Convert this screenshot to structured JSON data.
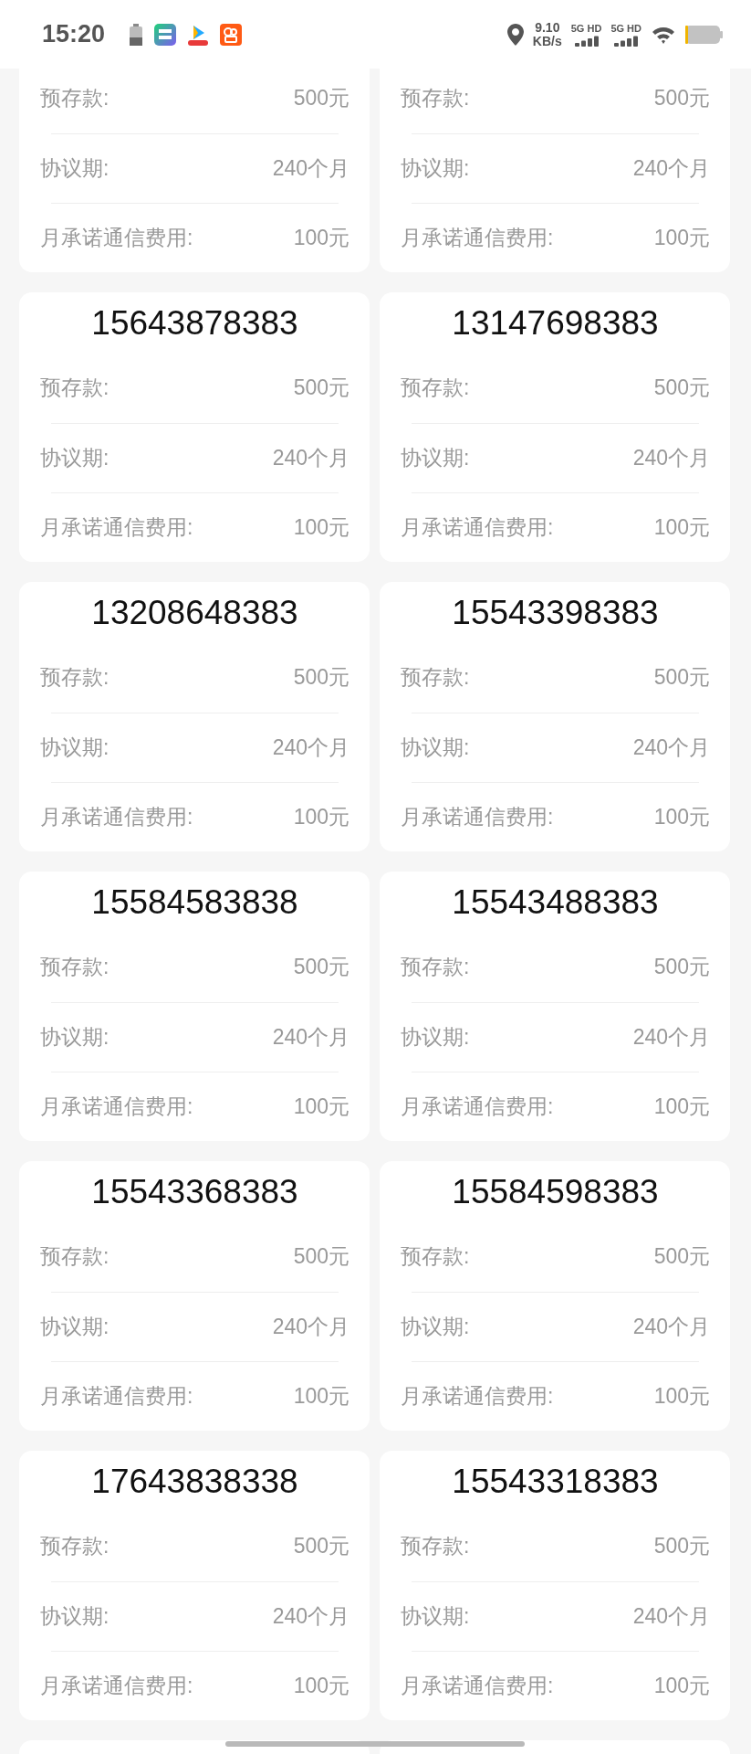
{
  "status_bar": {
    "time": "15:20",
    "speed": "9.10",
    "speed_unit": "KB/s",
    "networks": [
      "5G HD",
      "5G HD"
    ]
  },
  "cards": [
    {
      "details": [
        {
          "label": "预存款:",
          "value": "500元"
        },
        {
          "label": "协议期:",
          "value": "240个月"
        },
        {
          "label": "月承诺通信费用:",
          "value": "100元"
        }
      ]
    },
    {
      "details": [
        {
          "label": "预存款:",
          "value": "500元"
        },
        {
          "label": "协议期:",
          "value": "240个月"
        },
        {
          "label": "月承诺通信费用:",
          "value": "100元"
        }
      ]
    },
    {
      "number": "15643878383",
      "details": [
        {
          "label": "预存款:",
          "value": "500元"
        },
        {
          "label": "协议期:",
          "value": "240个月"
        },
        {
          "label": "月承诺通信费用:",
          "value": "100元"
        }
      ]
    },
    {
      "number": "13147698383",
      "details": [
        {
          "label": "预存款:",
          "value": "500元"
        },
        {
          "label": "协议期:",
          "value": "240个月"
        },
        {
          "label": "月承诺通信费用:",
          "value": "100元"
        }
      ]
    },
    {
      "number": "13208648383",
      "details": [
        {
          "label": "预存款:",
          "value": "500元"
        },
        {
          "label": "协议期:",
          "value": "240个月"
        },
        {
          "label": "月承诺通信费用:",
          "value": "100元"
        }
      ]
    },
    {
      "number": "15543398383",
      "details": [
        {
          "label": "预存款:",
          "value": "500元"
        },
        {
          "label": "协议期:",
          "value": "240个月"
        },
        {
          "label": "月承诺通信费用:",
          "value": "100元"
        }
      ]
    },
    {
      "number": "15584583838",
      "details": [
        {
          "label": "预存款:",
          "value": "500元"
        },
        {
          "label": "协议期:",
          "value": "240个月"
        },
        {
          "label": "月承诺通信费用:",
          "value": "100元"
        }
      ]
    },
    {
      "number": "15543488383",
      "details": [
        {
          "label": "预存款:",
          "value": "500元"
        },
        {
          "label": "协议期:",
          "value": "240个月"
        },
        {
          "label": "月承诺通信费用:",
          "value": "100元"
        }
      ]
    },
    {
      "number": "15543368383",
      "details": [
        {
          "label": "预存款:",
          "value": "500元"
        },
        {
          "label": "协议期:",
          "value": "240个月"
        },
        {
          "label": "月承诺通信费用:",
          "value": "100元"
        }
      ]
    },
    {
      "number": "15584598383",
      "details": [
        {
          "label": "预存款:",
          "value": "500元"
        },
        {
          "label": "协议期:",
          "value": "240个月"
        },
        {
          "label": "月承诺通信费用:",
          "value": "100元"
        }
      ]
    },
    {
      "number": "17643838338",
      "details": [
        {
          "label": "预存款:",
          "value": "500元"
        },
        {
          "label": "协议期:",
          "value": "240个月"
        },
        {
          "label": "月承诺通信费用:",
          "value": "100元"
        }
      ]
    },
    {
      "number": "15543318383",
      "details": [
        {
          "label": "预存款:",
          "value": "500元"
        },
        {
          "label": "协议期:",
          "value": "240个月"
        },
        {
          "label": "月承诺通信费用:",
          "value": "100元"
        }
      ]
    }
  ]
}
